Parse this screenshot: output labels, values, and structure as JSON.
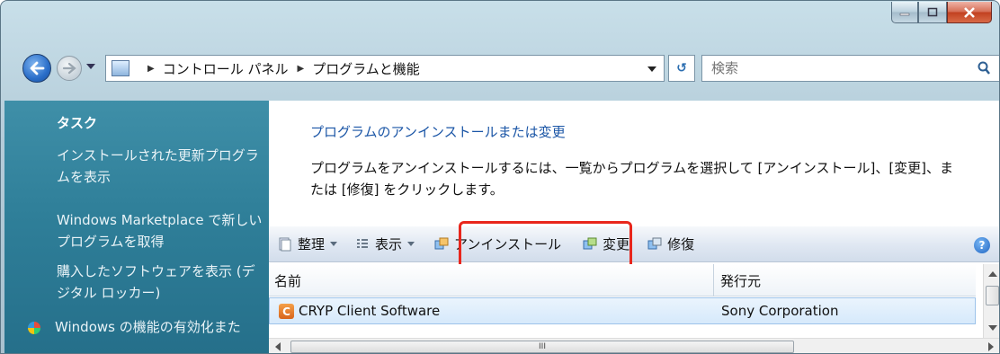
{
  "window": {
    "caption": {
      "minimize": "minimize-icon",
      "maximize": "maximize-icon",
      "close": "close-icon"
    }
  },
  "nav": {
    "breadcrumb": [
      "コントロール パネル",
      "プログラムと機能"
    ],
    "search_placeholder": "検索"
  },
  "sidebar": {
    "title": "タスク",
    "links": [
      "インストールされた更新プログラムを表示",
      "Windows Marketplace で新しいプログラムを取得",
      "購入したソフトウェアを表示 (デジタル ロッカー)",
      "Windows の機能の有効化また"
    ]
  },
  "main": {
    "heading": "プログラムのアンインストールまたは変更",
    "description": "プログラムをアンインストールするには、一覧からプログラムを選択して [アンインストール]、[変更]、または [修復] をクリックします。",
    "toolbar": {
      "organize": "整理",
      "view": "表示",
      "uninstall": "アンインストール",
      "change": "変更",
      "repair": "修復",
      "help": "?"
    },
    "columns": [
      "名前",
      "発行元"
    ],
    "rows": [
      {
        "name": "CRYP Client Software",
        "publisher": "Sony Corporation"
      }
    ],
    "hscroll_grip": "III"
  },
  "colors": {
    "highlight": "#e8261c",
    "sidebar_bg": "#2f7f99",
    "link": "#1a55a6",
    "selection": "#d6e9fb"
  }
}
